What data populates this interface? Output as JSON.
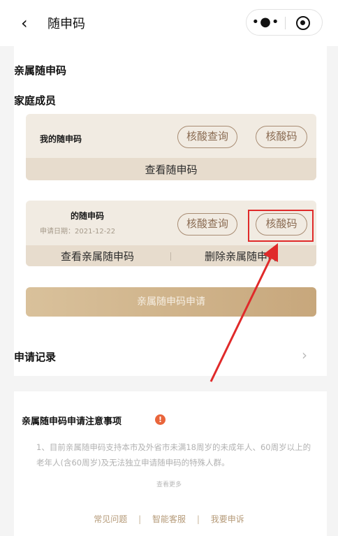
{
  "nav": {
    "back_icon": "‹",
    "title": "随申码",
    "more_icon": "•●•",
    "target_icon": "record"
  },
  "section_title": "亲属随申码",
  "family_title": "家庭成员",
  "my_card": {
    "name": "我的随申码",
    "btn_query": "核酸查询",
    "btn_code": "核酸码",
    "view": "查看随申码"
  },
  "relative_card": {
    "name": "的随申码",
    "apply_date": "申请日期：2021-12-22",
    "btn_query": "核酸查询",
    "btn_code": "核酸码",
    "view": "查看亲属随申码",
    "delete": "删除亲属随申码"
  },
  "apply_button": "亲属随申码申请",
  "record": {
    "label": "申请记录",
    "chevron": "›"
  },
  "notice": {
    "title": "亲属随申码申请注意事项",
    "warn_icon": "!",
    "text": "1、目前亲属随申码支持本市及外省市未满18周岁的未成年人、60周岁以上的老年人(含60周岁)及无法独立申请随申码的特殊人群。",
    "more": "查看更多"
  },
  "footer": {
    "faq": "常见问题",
    "service": "智能客服",
    "complaint": "我要申诉",
    "separator": "|"
  },
  "colors": {
    "card_bg": "#f1ebe2",
    "card_bottom": "#e7dccd",
    "pill_border": "#a88c73",
    "highlight": "#e02a2a",
    "apply_gradient_start": "#d9c19b",
    "apply_gradient_end": "#c7a77c"
  }
}
